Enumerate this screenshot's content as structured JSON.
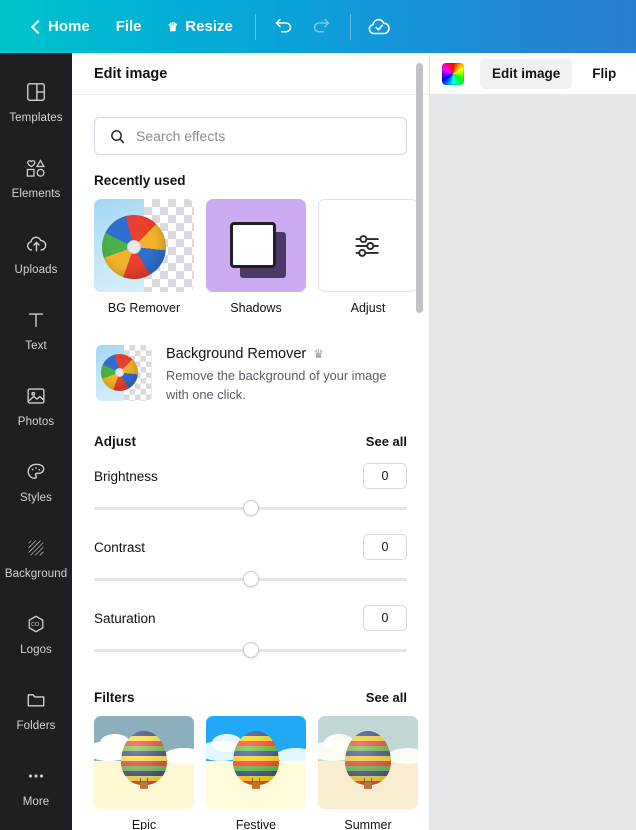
{
  "topbar": {
    "back_label": "Home",
    "file_label": "File",
    "resize_label": "Resize",
    "resize_crown": "♛",
    "undo_title": "Undo",
    "redo_title": "Redo",
    "saved_title": "All changes saved"
  },
  "rail": {
    "items": [
      {
        "label": "Templates",
        "icon": "templates-icon"
      },
      {
        "label": "Elements",
        "icon": "elements-icon"
      },
      {
        "label": "Uploads",
        "icon": "uploads-icon"
      },
      {
        "label": "Text",
        "icon": "text-icon"
      },
      {
        "label": "Photos",
        "icon": "photos-icon"
      },
      {
        "label": "Styles",
        "icon": "styles-icon"
      },
      {
        "label": "Background",
        "icon": "background-icon"
      },
      {
        "label": "Logos",
        "icon": "logos-icon"
      },
      {
        "label": "Folders",
        "icon": "folders-icon"
      },
      {
        "label": "More",
        "icon": "more-icon"
      }
    ]
  },
  "panel": {
    "title": "Edit image",
    "search": {
      "placeholder": "Search effects",
      "value": ""
    },
    "recently_used": {
      "title": "Recently used",
      "tiles": [
        {
          "label": "BG Remover",
          "art": "beach-ball-transparent"
        },
        {
          "label": "Shadows",
          "art": "shadow-square"
        },
        {
          "label": "Adjust",
          "art": "sliders"
        }
      ]
    },
    "background_remover": {
      "title": "Background Remover",
      "crown": "♛",
      "description": "Remove the background of your image with one click."
    },
    "adjust": {
      "title": "Adjust",
      "see_all": "See all",
      "controls": [
        {
          "name": "Brightness",
          "value": "0",
          "position_pct": 50
        },
        {
          "name": "Contrast",
          "value": "0",
          "position_pct": 50
        },
        {
          "name": "Saturation",
          "value": "0",
          "position_pct": 50
        }
      ]
    },
    "filters": {
      "title": "Filters",
      "see_all": "See all",
      "items": [
        {
          "label": "Epic",
          "sky": "#7fa8bd",
          "ground": "#ece4c6",
          "saturate": 0.95,
          "contrast": 1.12
        },
        {
          "label": "Festive",
          "sky": "#3ba3df",
          "ground": "#fdf6dc",
          "saturate": 1.25,
          "contrast": 1.05
        },
        {
          "label": "Summer",
          "sky": "#bcd6d8",
          "ground": "#f4ecd2",
          "saturate": 1.08,
          "contrast": 0.98
        }
      ]
    },
    "scrollbar": {
      "thumb_top_pct": 1,
      "thumb_height_pct": 34
    }
  },
  "stage": {
    "color_swatch_name": "rainbow-gradient",
    "buttons": [
      {
        "label": "Edit image",
        "active": true
      },
      {
        "label": "Flip",
        "active": false
      }
    ]
  },
  "colors": {
    "brand_teal": "#00c4cc",
    "brand_blue": "#2a7fd1",
    "rail_bg": "#1f1f23",
    "canvas_bg": "#e6e7eb",
    "shadow_tile_bg": "#ccaaf0"
  }
}
